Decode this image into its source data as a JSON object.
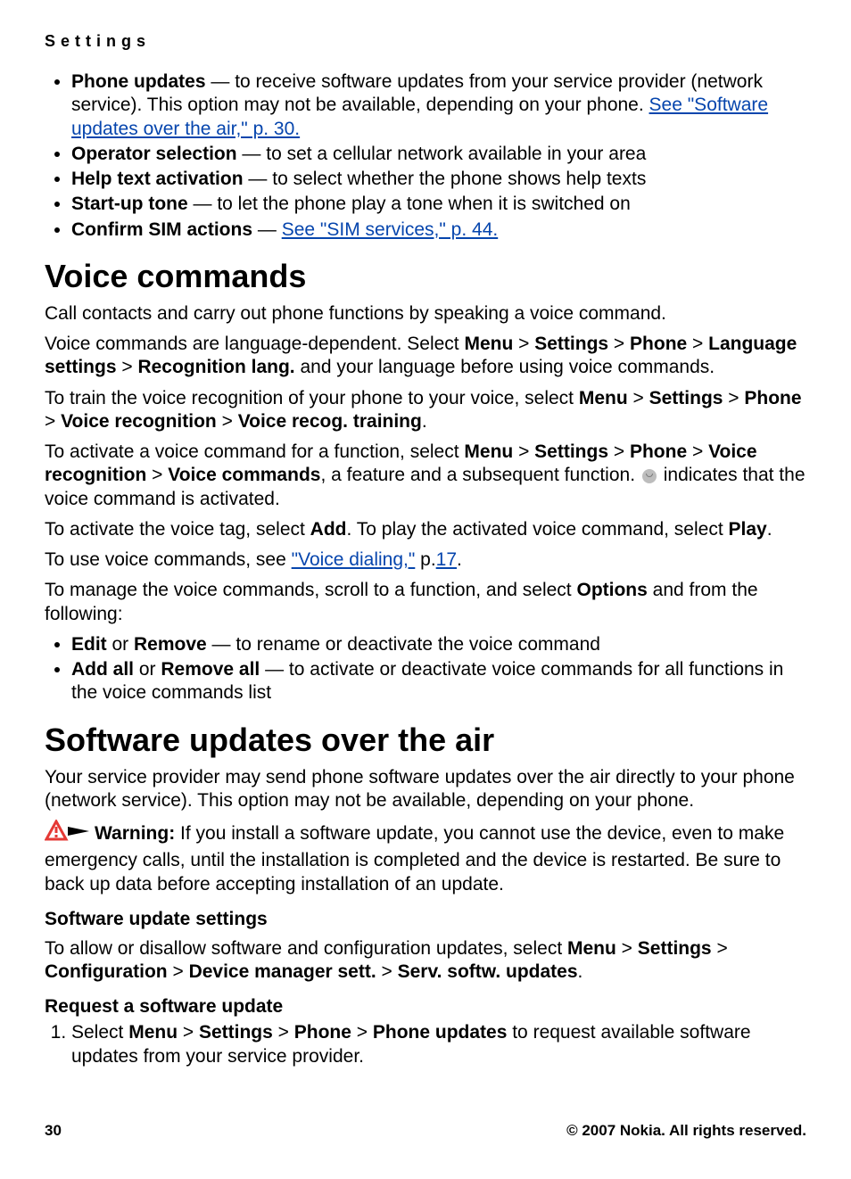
{
  "chapter": "Settings",
  "top_bullets": [
    {
      "label": "Phone updates",
      "rest1": " — to receive software updates from your service provider (network service). This option may not be available, depending on your phone. ",
      "link": "See \"Software updates over the air,\" p. 30."
    },
    {
      "label": "Operator selection",
      "rest1": " — to set a cellular network available in your area"
    },
    {
      "label": "Help text activation",
      "rest1": " — to select whether the phone shows help texts"
    },
    {
      "label": "Start-up tone",
      "rest1": " — to let the phone play a tone when it is switched on"
    },
    {
      "label": "Confirm SIM actions",
      "rest1": " — ",
      "link": "See \"SIM services,\" p. 44."
    }
  ],
  "section1": {
    "title": "Voice commands",
    "p1": "Call contacts and carry out phone functions by speaking a voice command.",
    "p2": {
      "t1": "Voice commands are language-dependent. Select ",
      "menu": "Menu",
      "gt": " > ",
      "settings": "Settings",
      "phone": "Phone",
      "lang_settings": "Language settings",
      "recog": "Recognition lang.",
      "t2": " and your language before using voice commands."
    },
    "p3": {
      "t1": "To train the voice recognition of your phone to your voice, select ",
      "menu": "Menu",
      "gt": " > ",
      "settings": "Settings",
      "phone": "Phone",
      "vr": "Voice recognition",
      "training": "Voice recog. training",
      "dot": "."
    },
    "p4": {
      "t1": "To activate a voice command for a function, select ",
      "menu": "Menu",
      "gt": " > ",
      "settings": "Settings",
      "phone": "Phone",
      "vr": "Voice recognition",
      "vc": "Voice commands",
      "t2": ", a feature and a subsequent function. ",
      "t3": " indicates that the voice command is activated."
    },
    "p5": {
      "t1": "To activate the voice tag, select ",
      "add": "Add",
      "t2": ". To play the activated voice command, select ",
      "play": "Play",
      "dot": "."
    },
    "p6": {
      "t1": "To use voice commands, see ",
      "link": "\"Voice dialing,\"",
      "p": " p.",
      "pagelink": "17",
      "dot": "."
    },
    "p7": {
      "t1": "To manage the voice commands, scroll to a function, and select ",
      "options": "Options",
      "t2": " and from the following:"
    },
    "bullets": [
      {
        "a": "Edit",
        "or": " or ",
        "b": "Remove",
        "rest": " — to rename or deactivate the voice command"
      },
      {
        "a": "Add all",
        "or": " or ",
        "b": "Remove all",
        "rest": " — to activate or deactivate voice commands for all functions in the voice commands list"
      }
    ]
  },
  "section2": {
    "title": "Software updates over the air",
    "p1": "Your service provider may send phone software updates over the air directly to your phone (network service). This option may not be available, depending on your phone.",
    "warning": {
      "label": "Warning:",
      "text": " If you install a software update, you cannot use the device, even to make emergency calls, until the installation is completed and the device is restarted. Be sure to back up data before accepting installation of an update."
    },
    "sub1": "Software update settings",
    "p2": {
      "t1": "To allow or disallow software and configuration updates, select ",
      "menu": "Menu",
      "gt": " > ",
      "settings": "Settings",
      "config": "Configuration",
      "dms": "Device manager sett.",
      "ssu": "Serv. softw. updates",
      "dot": "."
    },
    "sub2": "Request a software update",
    "step1": {
      "t1": "Select ",
      "menu": "Menu",
      "gt": " > ",
      "settings": "Settings",
      "phone": "Phone",
      "pu": "Phone updates",
      "t2": " to request available software updates from your service provider."
    }
  },
  "footer": {
    "page": "30",
    "copy": "© 2007 Nokia. All rights reserved."
  }
}
